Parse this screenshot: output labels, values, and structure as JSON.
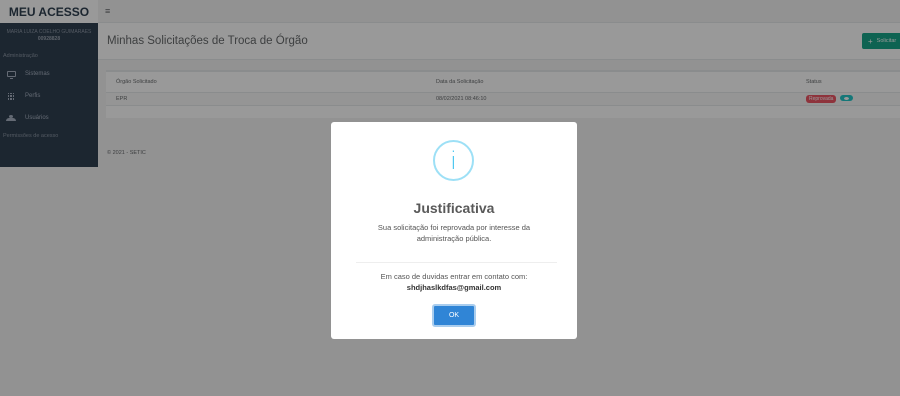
{
  "sidebar": {
    "brand": "MEU ACESSO",
    "user_name": "MARIA LUIZA COELHO GUIMARÃES",
    "user_id": "00928828",
    "section1": "Administração",
    "items": [
      {
        "label": "Sistemas",
        "icon": "monitor-icon"
      },
      {
        "label": "Perfis",
        "icon": "grid-icon"
      },
      {
        "label": "Usuários",
        "icon": "users-icon"
      }
    ],
    "section2": "Permissões de acesso"
  },
  "topbar": {
    "menu_icon": "hamburger-icon",
    "menu_glyph": "≡"
  },
  "heading": {
    "title": "Minhas Solicitações de Troca de Órgão",
    "new_button": "Solicitar"
  },
  "table": {
    "columns": [
      "Órgão Solicitado",
      "Data da Solicitação",
      "Status"
    ],
    "rows": [
      {
        "orgao": "EPR",
        "data": "08/02/2021 08:46:10",
        "status": "Reprovada"
      }
    ]
  },
  "footer": "© 2021 - SETIC",
  "modal": {
    "icon": "info-icon",
    "icon_glyph": "i",
    "title": "Justificativa",
    "message": "Sua solicitação foi reprovada por interesse da administração pública.",
    "contact_text": "Em caso de duvidas entrar em contato com:",
    "contact_email": "shdjhaslkdfas@gmail.com",
    "ok_label": "OK"
  },
  "colors": {
    "sidebar_bg": "#2f4050",
    "primary_green": "#18a689",
    "danger": "#ed5565",
    "info": "#23c6c8",
    "ok_button": "#3085d6"
  }
}
